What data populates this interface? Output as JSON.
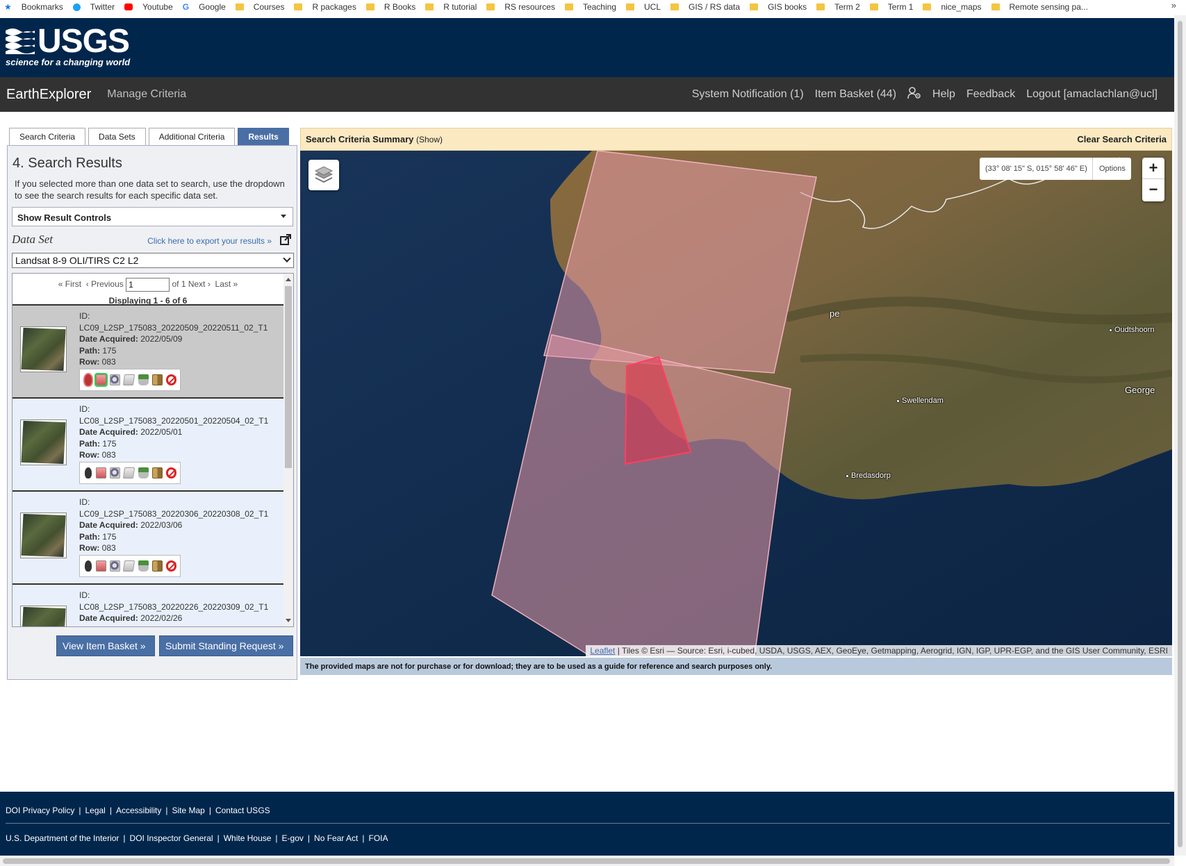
{
  "bookmarks": [
    {
      "label": "Bookmarks",
      "icon": "star-icon"
    },
    {
      "label": "Twitter",
      "icon": "twitter-icon"
    },
    {
      "label": "Youtube",
      "icon": "youtube-icon"
    },
    {
      "label": "Google",
      "icon": "google-icon"
    },
    {
      "label": "Courses",
      "icon": "folder-icon"
    },
    {
      "label": "R packages",
      "icon": "folder-icon"
    },
    {
      "label": "R Books",
      "icon": "folder-icon"
    },
    {
      "label": "R tutorial",
      "icon": "folder-icon"
    },
    {
      "label": "RS resources",
      "icon": "folder-icon"
    },
    {
      "label": "Teaching",
      "icon": "folder-icon"
    },
    {
      "label": "UCL",
      "icon": "folder-icon"
    },
    {
      "label": "GIS / RS data",
      "icon": "folder-icon"
    },
    {
      "label": "GIS books",
      "icon": "folder-icon"
    },
    {
      "label": "Term 2",
      "icon": "folder-icon"
    },
    {
      "label": "Term 1",
      "icon": "folder-icon"
    },
    {
      "label": "nice_maps",
      "icon": "folder-icon"
    },
    {
      "label": "Remote sensing pa...",
      "icon": "folder-icon"
    }
  ],
  "bookmarks_more": "»",
  "header": {
    "logo_word": "USGS",
    "logo_tagline": "science for a changing world"
  },
  "nav": {
    "brand": "EarthExplorer",
    "manage": "Manage Criteria",
    "notification": "System Notification (1)",
    "basket": "Item Basket (44)",
    "help": "Help",
    "feedback": "Feedback",
    "logout": "Logout [amaclachlan@ucl]"
  },
  "tabs": [
    "Search Criteria",
    "Data Sets",
    "Additional Criteria",
    "Results"
  ],
  "panel": {
    "title": "4. Search Results",
    "help": "If you selected more than one data set to search, use the dropdown to see the search results for each specific data set.",
    "result_controls": "Show Result Controls",
    "dataset_label": "Data Set",
    "export_link": "Click here to export your results »",
    "dataset_value": "Landsat 8-9 OLI/TIRS C2 L2"
  },
  "pager": {
    "first": "« First",
    "previous": "‹ Previous",
    "page": "1",
    "of": "of 1",
    "next": "Next ›",
    "last": "Last »",
    "displaying": "Displaying 1 - 6 of 6"
  },
  "result_labels": {
    "id": "ID:",
    "date": "Date Acquired:",
    "path": "Path:",
    "row": "Row:"
  },
  "results": [
    {
      "id": "LC09_L2SP_175083_20220509_20220511_02_T1",
      "date": "2022/05/09",
      "path": "175",
      "row": "083"
    },
    {
      "id": "LC08_L2SP_175083_20220501_20220504_02_T1",
      "date": "2022/05/01",
      "path": "175",
      "row": "083"
    },
    {
      "id": "LC09_L2SP_175083_20220306_20220308_02_T1",
      "date": "2022/03/06",
      "path": "175",
      "row": "083"
    },
    {
      "id": "LC08_L2SP_175083_20220226_20220309_02_T1",
      "date": "2022/02/26",
      "path": "",
      "row": ""
    }
  ],
  "buttons": {
    "basket": "View Item Basket »",
    "standing": "Submit Standing Request »"
  },
  "map": {
    "criteria_title": "Search Criteria Summary",
    "criteria_show": "(Show)",
    "clear": "Clear Search Criteria",
    "coords": "(33° 08' 15\" S, 015° 58' 46\" E)",
    "options": "Options",
    "zoom_in": "+",
    "zoom_out": "−",
    "places": [
      "Oudtshoorn",
      "George",
      "Swellendam",
      "Bredasdorp",
      "pe"
    ],
    "attribution_link": "Leaflet",
    "attribution_text": "| Tiles © Esri — Source: Esri, i-cubed, USDA, USGS, AEX, GeoEye, Getmapping, Aerogrid, IGN, IGP, UPR-EGP, and the GIS User Community, ESRI",
    "disclaimer": "The provided maps are not for purchase or for download; they are to be used as a guide for reference and search purposes only."
  },
  "footer": {
    "row1": [
      "DOI Privacy Policy",
      "Legal",
      "Accessibility",
      "Site Map",
      "Contact USGS"
    ],
    "row2": [
      "U.S. Department of the Interior",
      "DOI Inspector General",
      "White House",
      "E-gov",
      "No Fear Act",
      "FOIA"
    ],
    "sep": "|"
  },
  "colors": {
    "header_bg": "#00264c",
    "nav_bg": "#323232",
    "tab_active": "#4a6fa5",
    "criteria_bar": "#fbe9c2",
    "footprint": "#e89aa8",
    "selected_footprint": "#e0304a"
  }
}
